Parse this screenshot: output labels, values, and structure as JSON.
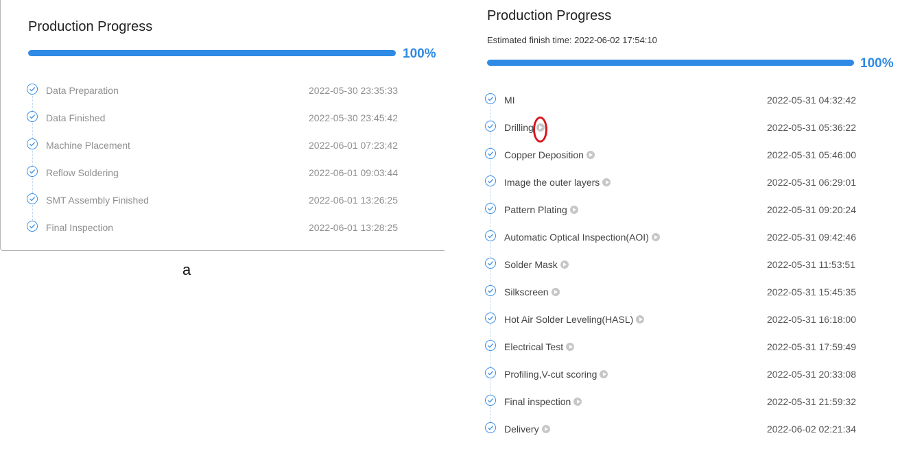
{
  "panel_a": {
    "title": "Production Progress",
    "progress_percent": 100,
    "progress_label": "100%",
    "steps": [
      {
        "name": "Data Preparation",
        "time": "2022-05-30 23:35:33"
      },
      {
        "name": "Data Finished",
        "time": "2022-05-30 23:45:42"
      },
      {
        "name": "Machine Placement",
        "time": "2022-06-01 07:23:42"
      },
      {
        "name": "Reflow Soldering",
        "time": "2022-06-01 09:03:44"
      },
      {
        "name": "SMT Assembly Finished",
        "time": "2022-06-01 13:26:25"
      },
      {
        "name": "Final Inspection",
        "time": "2022-06-01 13:28:25"
      }
    ]
  },
  "caption": "a",
  "panel_b": {
    "title": "Production Progress",
    "subtitle": "Estimated finish time: 2022-06-02 17:54:10",
    "progress_percent": 100,
    "progress_label": "100%",
    "steps": [
      {
        "name": "MI",
        "time": "2022-05-31 04:32:42",
        "has_play": false
      },
      {
        "name": "Drilling",
        "time": "2022-05-31 05:36:22",
        "has_play": true
      },
      {
        "name": "Copper Deposition",
        "time": "2022-05-31 05:46:00",
        "has_play": true
      },
      {
        "name": "Image the outer layers",
        "time": "2022-05-31 06:29:01",
        "has_play": true
      },
      {
        "name": "Pattern Plating",
        "time": "2022-05-31 09:20:24",
        "has_play": true
      },
      {
        "name": "Automatic Optical Inspection(AOI)",
        "time": "2022-05-31 09:42:46",
        "has_play": true
      },
      {
        "name": "Solder Mask",
        "time": "2022-05-31 11:53:51",
        "has_play": true
      },
      {
        "name": "Silkscreen",
        "time": "2022-05-31 15:45:35",
        "has_play": true
      },
      {
        "name": "Hot Air Solder Leveling(HASL)",
        "time": "2022-05-31 16:18:00",
        "has_play": true
      },
      {
        "name": "Electrical Test",
        "time": "2022-05-31 17:59:49",
        "has_play": true
      },
      {
        "name": "Profiling,V-cut scoring",
        "time": "2022-05-31 20:33:08",
        "has_play": true
      },
      {
        "name": "Final inspection",
        "time": "2022-05-31 21:59:32",
        "has_play": true
      },
      {
        "name": "Delivery",
        "time": "2022-06-02 02:21:34",
        "has_play": true
      }
    ]
  },
  "colors": {
    "accent": "#2f8ae5",
    "highlight_ring": "#d6141e",
    "muted_text": "#8f8f8f"
  },
  "icons": {
    "close": "close-icon",
    "check": "check-circle-icon",
    "play": "play-circle-icon"
  }
}
